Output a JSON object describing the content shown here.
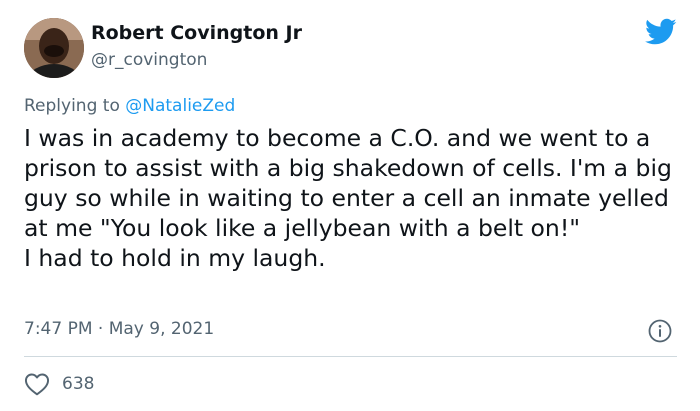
{
  "author": {
    "display_name": "Robert Covington Jr",
    "handle": "@r_covington",
    "avatar_icon": "profile-photo"
  },
  "reply": {
    "prefix": "Replying to ",
    "mention": "@NatalieZed"
  },
  "tweet": {
    "text": "I was in academy to become a C.O. and we went to a prison to assist with a big shakedown of cells. I'm a big guy so while in waiting to enter a cell an inmate yelled at me \"You look like a jellybean with a belt on!\"\nI had to hold in my laugh.",
    "timestamp": "7:47 PM · May 9, 2021"
  },
  "stats": {
    "likes": "638"
  },
  "icons": {
    "brand": "twitter-bird-icon",
    "info": "info-icon",
    "like": "heart-icon"
  },
  "colors": {
    "brand": "#1d9bf0",
    "text": "#0f1419",
    "secondary_text": "#536471",
    "divider": "#cfd9de"
  }
}
